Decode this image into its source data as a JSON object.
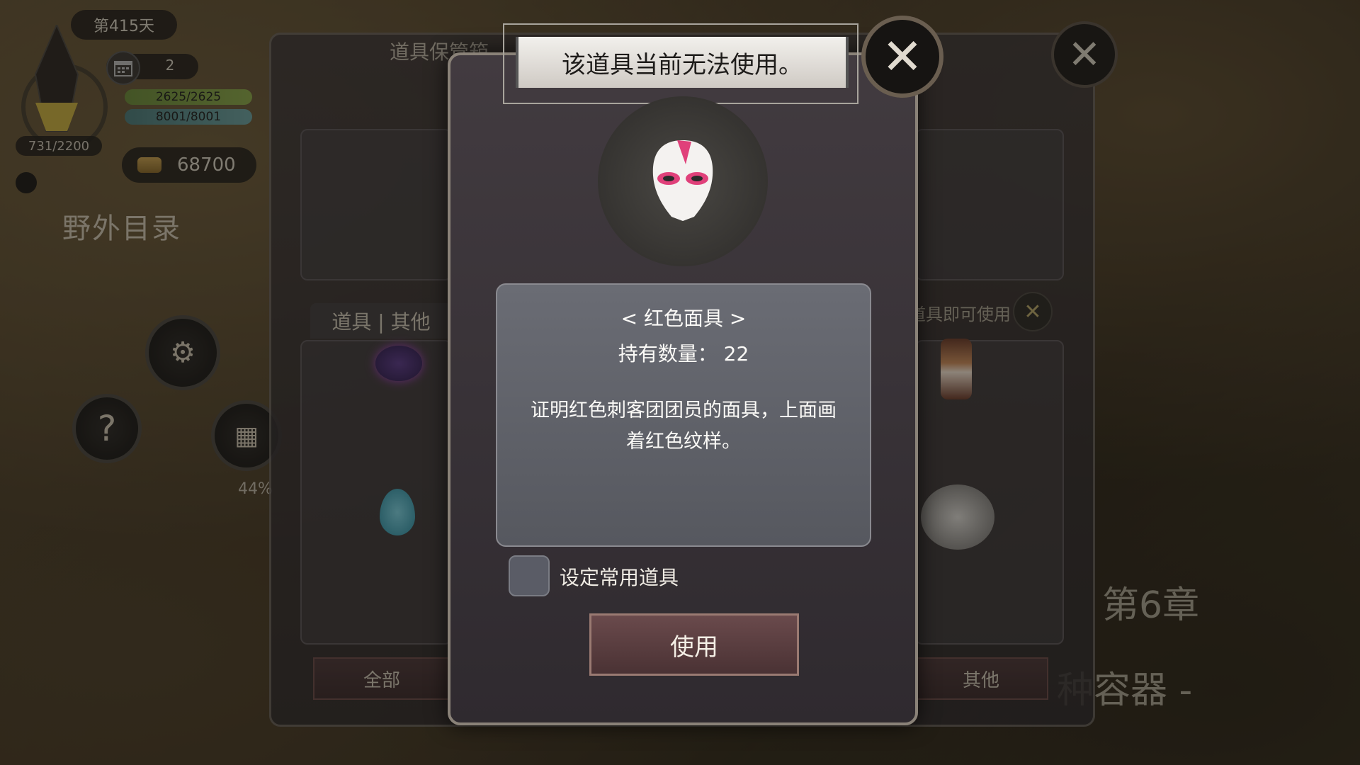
{
  "hud": {
    "day": "第415天",
    "calendar_count": "2",
    "hp": "2625/2625",
    "mp": "8001/8001",
    "xp": "731/2200",
    "gold": "68700",
    "field_directory": "野外目录",
    "percent": "44%",
    "chapter": "第6章",
    "container_label": "种容器 -"
  },
  "background_panel": {
    "title": "道具保管箱",
    "tabs": "道具 | 其他",
    "hint": "点击道具即可使用",
    "bottom_tabs": [
      "全部",
      "其他"
    ]
  },
  "modal": {
    "message": "该道具当前无法使用。",
    "item_name": "< 红色面具 >",
    "quantity": "持有数量： 22",
    "description": "证明红色刺客团团员的面具，上面画着红色纹样。",
    "favorite_label": "设定常用道具",
    "use_button": "使用"
  },
  "colors": {
    "accent_pink": "#e0407a",
    "gold": "#c8a050"
  }
}
